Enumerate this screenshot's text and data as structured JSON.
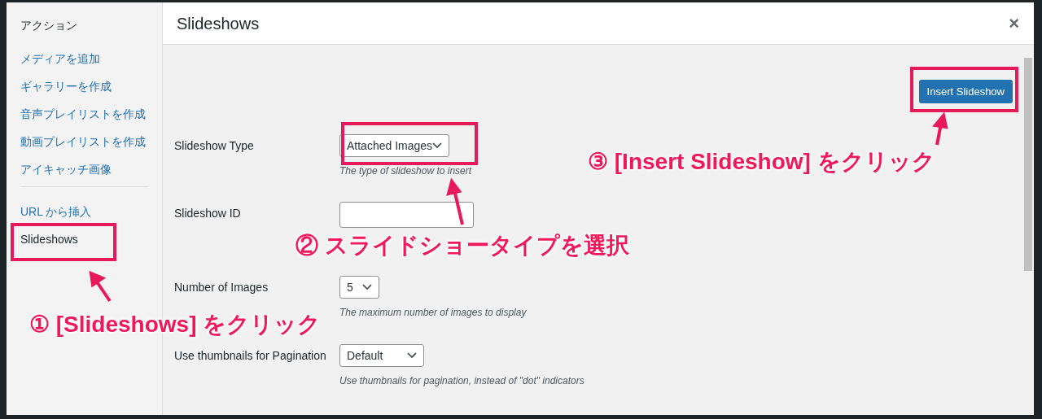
{
  "sidebar": {
    "heading": "アクション",
    "items": [
      {
        "label": "メディアを追加",
        "selected": false
      },
      {
        "label": "ギャラリーを作成",
        "selected": false
      },
      {
        "label": "音声プレイリストを作成",
        "selected": false
      },
      {
        "label": "動画プレイリストを作成",
        "selected": false
      },
      {
        "label": "アイキャッチ画像",
        "selected": false
      }
    ],
    "items_after_divider": [
      {
        "label": "URL から挿入",
        "selected": false
      },
      {
        "label": "Slideshows",
        "selected": true
      }
    ]
  },
  "modal": {
    "title": "Slideshows",
    "close": "×",
    "insert_button": "Insert Slideshow",
    "fields": [
      {
        "kind": "select",
        "label": "Slideshow Type",
        "value": "Attached Images",
        "hint": "The type of slideshow to insert"
      },
      {
        "kind": "text",
        "label": "Slideshow ID"
      },
      {
        "kind": "select",
        "label": "Number of Images",
        "value": "5",
        "hint": "The maximum number of images to display"
      },
      {
        "kind": "select",
        "label": "Use thumbnails for Pagination",
        "value": "Default",
        "hint": "Use thumbnails for pagination, instead of \"dot\" indicators"
      }
    ]
  },
  "annotations": [
    {
      "text": "① [Slideshows] をクリック"
    },
    {
      "text": "② スライドショータイプを選択"
    },
    {
      "text": "③ [Insert Slideshow] をクリック"
    }
  ]
}
